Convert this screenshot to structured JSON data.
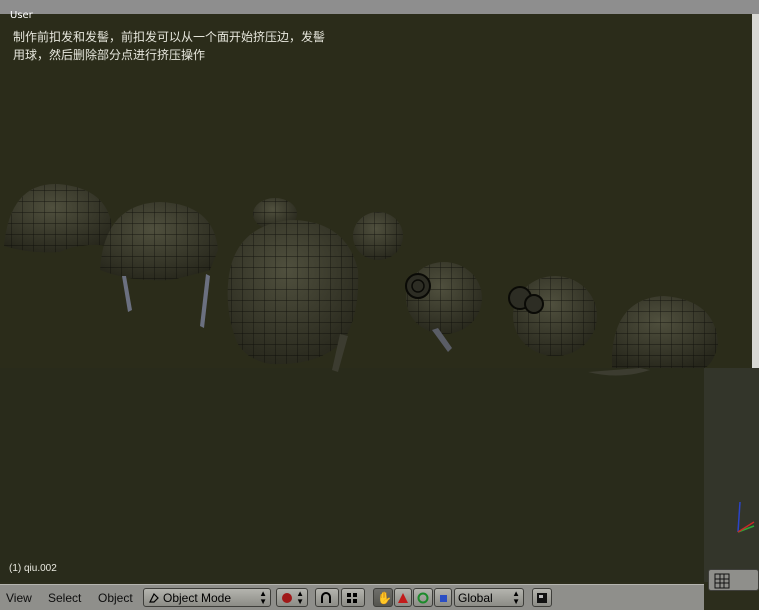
{
  "viewport": {
    "view_label": "User",
    "caption_line1": "制作前扣发和发髻，前扣发可以从一个面开始挤压边，发髻",
    "caption_line2": "用球，然后删除部分点进行挤压操作",
    "object_label": "(1) qiu.002"
  },
  "header": {
    "menus": [
      "View",
      "Select",
      "Object"
    ],
    "mode_label": "Object Mode",
    "orientation_label": "Global"
  },
  "colors": {
    "viewport_bg": "#2c2d1c",
    "header_bg": "#8f8f8b",
    "mesh_fill": "#3a3a2d",
    "wire": "#0a0a06",
    "axis_x": "#c82828",
    "axis_y": "#2ca83a",
    "axis_z": "#2b44c8"
  },
  "icons": {
    "mode": "object-mode-icon",
    "draw_type": "sphere-shading-icon",
    "pivot": "magnet-icon",
    "snap": "snap-grid-icon",
    "manipulator_hand": "hand-icon",
    "translate": "triangle-translate-icon",
    "rotate": "rotate-circle-icon",
    "scale": "scale-square-icon",
    "layer": "layer-icon",
    "grid": "grid-icon"
  }
}
